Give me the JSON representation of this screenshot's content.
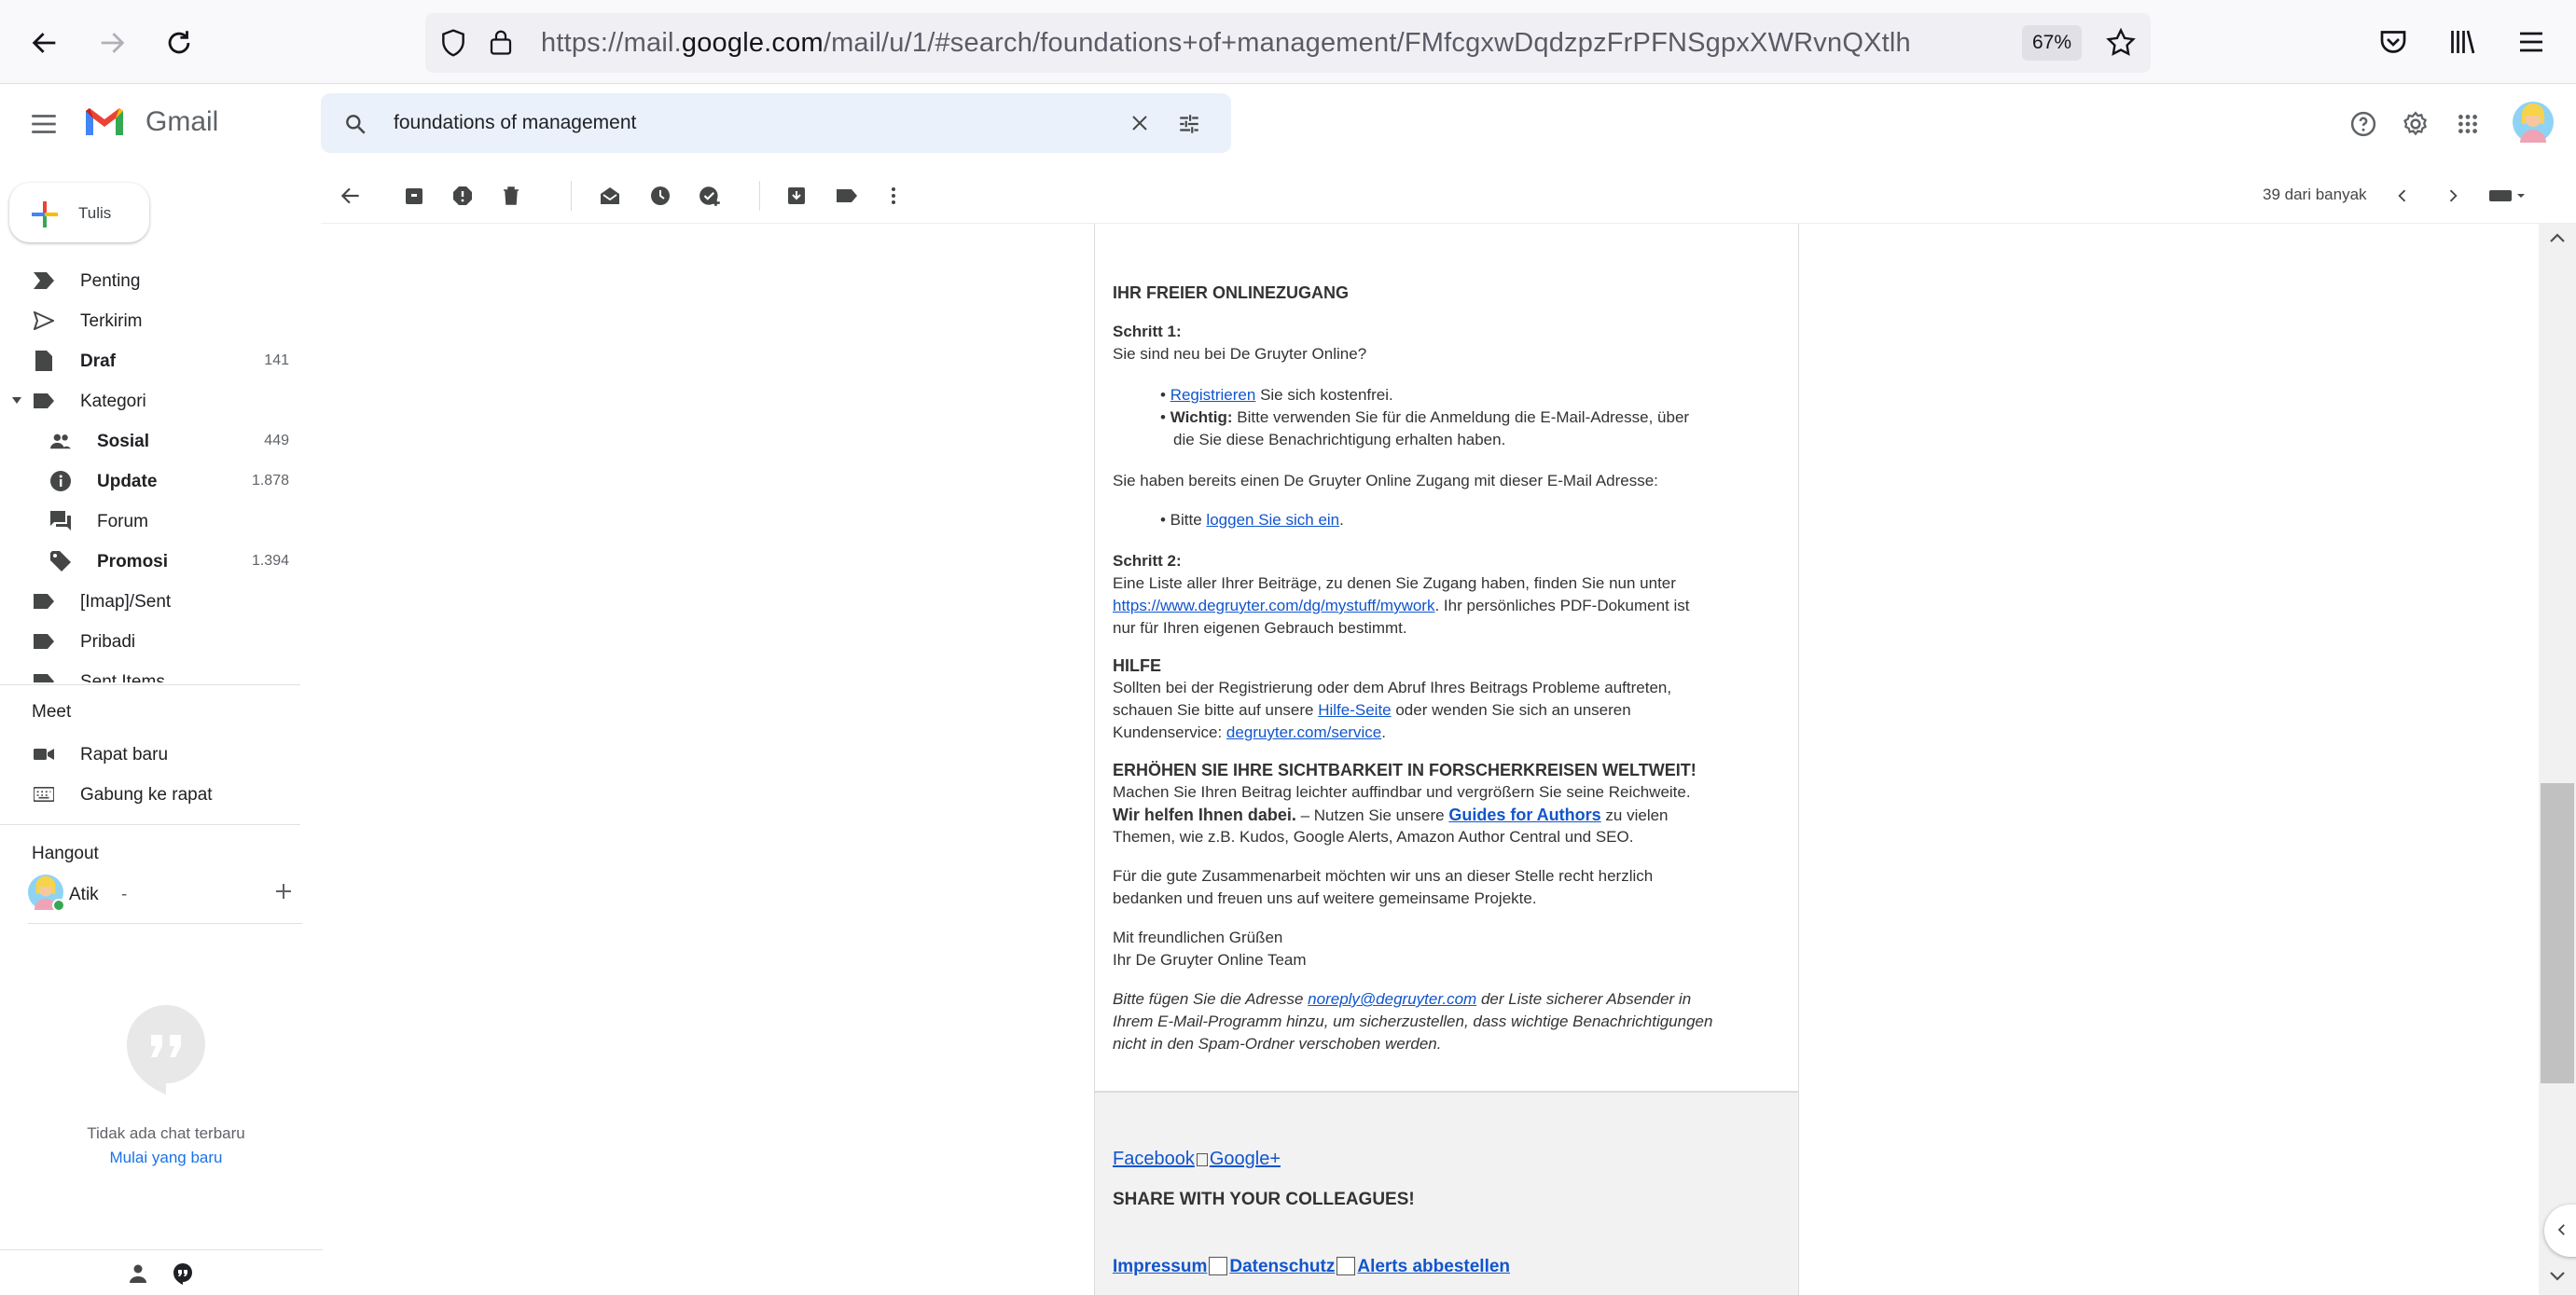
{
  "browser": {
    "url_prefix": "https://mail.",
    "url_domain": "google.com",
    "url_suffix": "/mail/u/1/#search/foundations+of+management/FMfcgxwDqdzpzFrPFNSgpxXWRvnQXtlh",
    "zoom": "67%"
  },
  "header": {
    "app_name": "Gmail",
    "search_value": "foundations of management"
  },
  "toolbar": {
    "page_count": "39 dari banyak"
  },
  "sidebar": {
    "compose_label": "Tulis",
    "items": [
      {
        "label": "Penting",
        "count": "",
        "icon": "label-important-icon",
        "bold": false
      },
      {
        "label": "Terkirim",
        "count": "",
        "icon": "send-icon",
        "bold": false
      },
      {
        "label": "Draf",
        "count": "141",
        "icon": "draft-icon",
        "bold": true
      },
      {
        "label": "Kategori",
        "count": "",
        "icon": "label-icon",
        "bold": false
      },
      {
        "label": "Sosial",
        "count": "449",
        "icon": "people-icon",
        "bold": true
      },
      {
        "label": "Update",
        "count": "1.878",
        "icon": "info-icon",
        "bold": true
      },
      {
        "label": "Forum",
        "count": "",
        "icon": "forum-icon",
        "bold": false
      },
      {
        "label": "Promosi",
        "count": "1.394",
        "icon": "tag-icon",
        "bold": true
      },
      {
        "label": "[Imap]/Sent",
        "count": "",
        "icon": "label-icon",
        "bold": false
      },
      {
        "label": "Pribadi",
        "count": "",
        "icon": "label-icon",
        "bold": false
      },
      {
        "label": "Sent Items",
        "count": "",
        "icon": "label-icon",
        "bold": false
      }
    ],
    "meet_title": "Meet",
    "meet_items": [
      {
        "label": "Rapat baru",
        "icon": "video-icon"
      },
      {
        "label": "Gabung ke rapat",
        "icon": "keyboard-icon"
      }
    ],
    "hangout_title": "Hangout",
    "hangout_user": "Atik",
    "hangout_user_suffix": "-",
    "no_chat_text": "Tidak ada chat terbaru",
    "start_new_link": "Mulai yang baru"
  },
  "email": {
    "h1": "IHR FREIER ONLINEZUGANG",
    "step1_title": "Schritt 1:",
    "step1_q": "Sie sind neu bei De Gruyter Online?",
    "b1_link": "Registrieren",
    "b1_rest": " Sie sich kostenfrei.",
    "b2_bold": "Wichtig:",
    "b2_rest": " Bitte verwenden Sie für die Anmeldung die E-Mail-Adresse, über",
    "b2_line2": "die Sie diese Benachrichtigung erhalten haben.",
    "existing": "Sie haben bereits einen De Gruyter Online Zugang mit dieser E-Mail Adresse:",
    "b3_pre": "• Bitte ",
    "b3_link": "loggen Sie sich ein",
    "b3_post": ".",
    "step2_title": "Schritt 2:",
    "step2_l1": "Eine Liste aller Ihrer Beiträge, zu denen Sie Zugang haben, finden Sie nun unter",
    "step2_link": "https://www.degruyter.com/dg/mystuff/mywork",
    "step2_l2_rest": ". Ihr persönliches PDF-Dokument ist",
    "step2_l3": "nur für Ihren eigenen Gebrauch bestimmt.",
    "help_title": "HILFE",
    "help_l1": "Sollten bei der Registrierung oder dem Abruf Ihres Beitrags Probleme auftreten,",
    "help_l2_pre": "schauen Sie bitte auf unsere ",
    "help_link": "Hilfe-Seite",
    "help_l2_post": " oder wenden Sie sich an unseren",
    "help_l3_pre": "Kundenservice: ",
    "help_l3_link": "degruyter.com/service",
    "help_l3_post": ".",
    "vis_title": "ERHÖHEN SIE IHRE SICHTBARKEIT IN FORSCHERKREISEN WELTWEIT!",
    "vis_l1": "Machen Sie Ihren Beitrag leichter auffindbar und vergrößern Sie seine Reichweite.",
    "vis_l2_bold": "Wir helfen Ihnen dabei.",
    "vis_l2_mid": " – Nutzen Sie unsere ",
    "vis_l2_link": "Guides for Authors",
    "vis_l2_post": " zu vielen",
    "vis_l3": "Themen, wie z.B. Kudos, Google Alerts, Amazon Author Central und SEO.",
    "thanks_l1": "Für die gute Zusammenarbeit möchten wir uns an dieser Stelle recht herzlich",
    "thanks_l2": "bedanken und freuen uns auf weitere gemeinsame Projekte.",
    "greet_l1": "Mit freundlichen Grüßen",
    "greet_l2": "Ihr De Gruyter Online Team",
    "note_l1_pre": "Bitte fügen Sie die Adresse ",
    "note_link": "noreply@degruyter.com",
    "note_l1_post": " der Liste sicherer Absender in",
    "note_l2": "Ihrem E-Mail-Programm hinzu, um sicherzustellen, dass wichtige Benachrichtigungen",
    "note_l3": "nicht in den Spam-Ordner verschoben werden.",
    "foot_facebook": "Facebook",
    "foot_google": "Google+",
    "foot_share": "SHARE WITH YOUR COLLEAGUES!",
    "foot_impressum": "Impressum",
    "foot_datenschutz": "Datenschutz",
    "foot_alerts": "Alerts abbestellen"
  },
  "colors": {
    "link": "#1155cc",
    "search_bg": "#eaf1fb",
    "footer_bg": "#f2f2f2"
  }
}
